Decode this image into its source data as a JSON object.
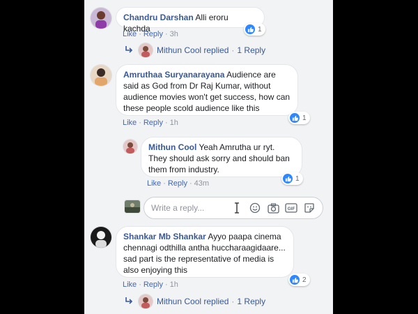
{
  "comments": [
    {
      "author": "Chandru Darshan",
      "text": "Alli eroru kachda",
      "actions": {
        "like": "Like",
        "reply": "Reply",
        "time": "3h"
      },
      "like_count": "1",
      "replied_summary": {
        "author": "Mithun Cool",
        "verb": "replied",
        "count_label": "1 Reply"
      }
    },
    {
      "author": "Amruthaa Suryanarayana",
      "text": "Audience are said as God from Dr Raj Kumar, without audience movies won't get success, how can these people scold audience like this",
      "actions": {
        "like": "Like",
        "reply": "Reply",
        "time": "1h"
      },
      "like_count": "1",
      "reply": {
        "author": "Mithun Cool",
        "text": "Yeah Amrutha ur ryt. They should ask sorry and should ban them from industry.",
        "actions": {
          "like": "Like",
          "reply": "Reply",
          "time": "43m"
        },
        "like_count": "1"
      },
      "reply_box": {
        "placeholder": "Write a reply..."
      }
    },
    {
      "author": "Shankar Mb Shankar",
      "text": "Ayyo paapa cinema chennagi odthilla antha huccharaagidaare... sad part is the representative of media is also enjoying this",
      "actions": {
        "like": "Like",
        "reply": "Reply",
        "time": "1h"
      },
      "like_count": "2",
      "replied_summary": {
        "author": "Mithun Cool",
        "verb": "replied",
        "count_label": "1 Reply"
      }
    }
  ],
  "colors": {
    "link": "#385898",
    "like_blue": "#2d88ff",
    "panel_bg": "#f2f3f5"
  },
  "icons": [
    "like-thumb-icon",
    "reply-arrow-icon",
    "emoji-icon",
    "camera-icon",
    "gif-icon",
    "sticker-icon",
    "text-cursor-icon"
  ]
}
